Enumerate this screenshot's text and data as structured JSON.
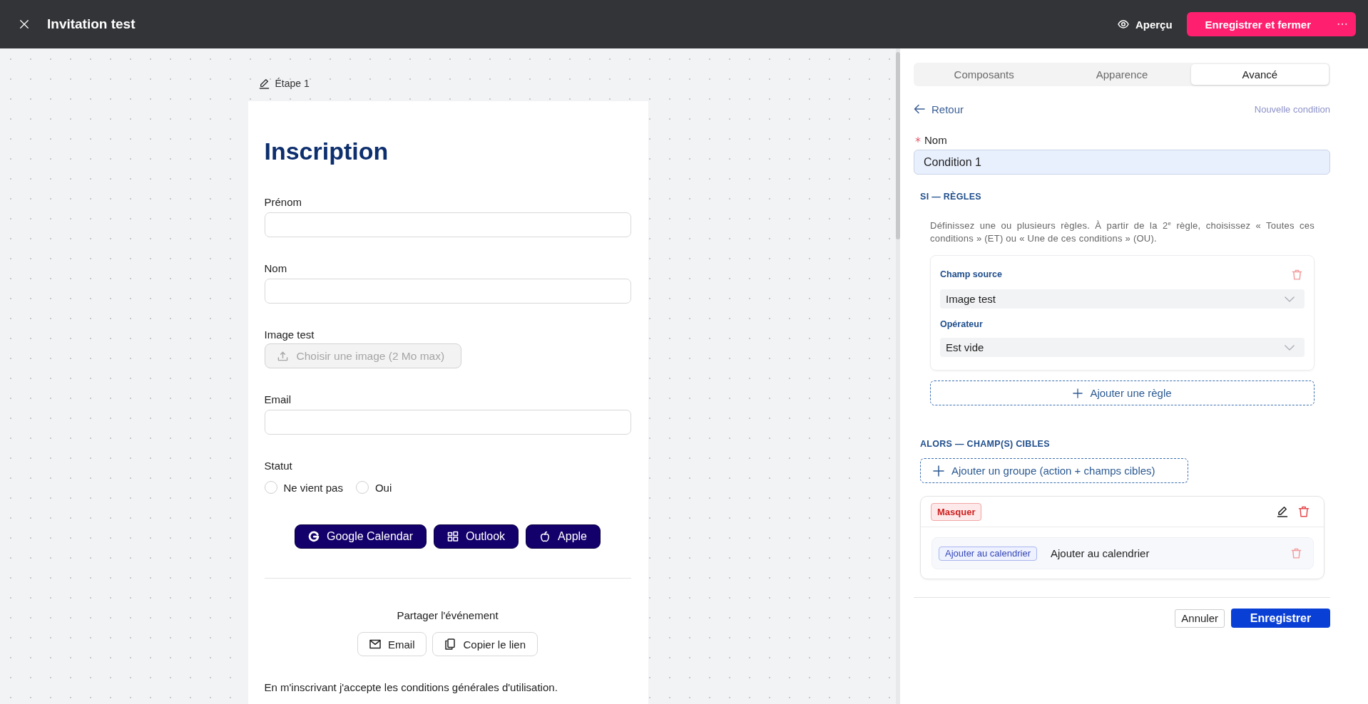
{
  "top_bar": {
    "title": "Invitation test",
    "preview": "Aperçu",
    "save_button": "Enregistrer et fermer"
  },
  "canvas": {
    "step_label": "Étape 1",
    "form": {
      "title": "Inscription",
      "fields": [
        {
          "kind": "text",
          "label": "Prénom"
        },
        {
          "kind": "text",
          "label": "Nom"
        },
        {
          "kind": "file",
          "label": "Image test",
          "button": "Choisir une image (2 Mo max)",
          "disabled": true
        },
        {
          "kind": "text",
          "label": "Email"
        },
        {
          "kind": "radio",
          "label": "Statut",
          "options": [
            {
              "label": "Ne vient pas",
              "selected": false
            },
            {
              "label": "Oui",
              "selected": false
            }
          ]
        }
      ],
      "calendar_buttons": [
        {
          "kind": "google",
          "label": "Google Calendar"
        },
        {
          "kind": "outlook",
          "label": "Outlook"
        },
        {
          "kind": "apple",
          "label": "Apple"
        }
      ],
      "share": {
        "title": "Partager l'événement",
        "buttons": [
          {
            "kind": "email",
            "label": "Email"
          },
          {
            "kind": "link",
            "label": "Copier le lien"
          }
        ]
      },
      "terms": "En m'inscrivant j'accepte les conditions générales d'utilisation."
    }
  },
  "panel": {
    "tabs": [
      {
        "label": "Composants",
        "selected": false
      },
      {
        "label": "Apparence",
        "selected": false
      },
      {
        "label": "Avancé",
        "selected": true
      }
    ],
    "back_link": "Retour",
    "subtitle": "Nouvelle condition",
    "name_field": {
      "label": "Nom",
      "required": true,
      "value": "Condition 1"
    },
    "rules_section": {
      "title": "SI — RÈGLES",
      "description": "Définissez une ou plusieurs règles. À partir de la 2$^{e}$ règle, choisissez « Toutes ces conditions » (ET) ou « Une de ces conditions » (OU).",
      "rules": [
        {
          "source_label": "Champ source",
          "source_value": "Image test",
          "operator_label": "Opérateur",
          "operator_value": "Est vide"
        }
      ],
      "add_button": "Ajouter une règle"
    },
    "targets_section": {
      "title": "ALORS — CHAMP(S) CIBLES",
      "add_button": "Ajouter un groupe (action + champs cibles)",
      "groups": [
        {
          "action": "Masquer",
          "targets": [
            {
              "tag": "Ajouter au calendrier",
              "name": "Ajouter au calendrier"
            }
          ]
        }
      ]
    },
    "footer": {
      "cancel": "Annuler",
      "save": "Enregistrer"
    }
  }
}
